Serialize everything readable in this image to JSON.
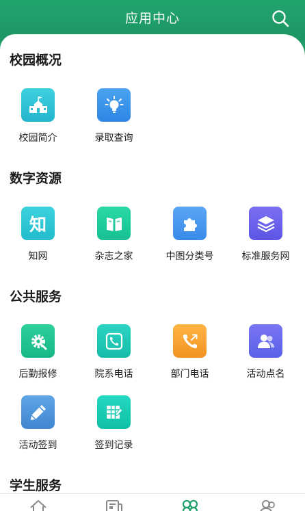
{
  "header": {
    "title": "应用中心",
    "search_icon": "search-icon"
  },
  "colors": {
    "brand": "#1f9e6a",
    "cyan": "#29c3d8",
    "blue": "#3a92ea",
    "green": "#19c49b",
    "teal": "#25cbbd",
    "purple": "#6d63ec",
    "orange": "#f5a12a"
  },
  "sections": [
    {
      "title": "校园概况",
      "items": [
        {
          "label": "校园简介",
          "icon": "school-building-icon"
        },
        {
          "label": "录取查询",
          "icon": "lightbulb-icon"
        }
      ]
    },
    {
      "title": "数字资源",
      "items": [
        {
          "label": "知网",
          "icon": "zhi-character-icon",
          "glyph": "知"
        },
        {
          "label": "杂志之家",
          "icon": "open-book-icon"
        },
        {
          "label": "中图分类号",
          "icon": "puzzle-icon"
        },
        {
          "label": "标准服务网",
          "icon": "layers-icon"
        }
      ]
    },
    {
      "title": "公共服务",
      "items": [
        {
          "label": "后勤报修",
          "icon": "gear-wrench-icon"
        },
        {
          "label": "院系电话",
          "icon": "phone-icon"
        },
        {
          "label": "部门电话",
          "icon": "phone-outgoing-icon"
        },
        {
          "label": "活动点名",
          "icon": "users-icon"
        },
        {
          "label": "活动签到",
          "icon": "pencil-icon"
        },
        {
          "label": "签到记录",
          "icon": "spreadsheet-edit-icon"
        }
      ]
    },
    {
      "title": "学生服务",
      "items": []
    }
  ],
  "tabbar": {
    "items": [
      {
        "icon": "home-icon"
      },
      {
        "icon": "news-icon"
      },
      {
        "icon": "apps-clover-icon",
        "active": true
      },
      {
        "icon": "profile-icon"
      }
    ]
  }
}
